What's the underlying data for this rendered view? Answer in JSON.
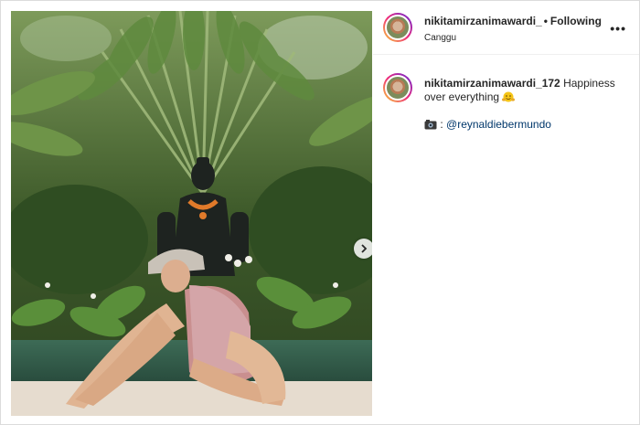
{
  "post": {
    "username": "nikitamirzanimawardi_",
    "dot": "•",
    "follow_status": "Following",
    "location": "Canggu",
    "more_icon": "•••"
  },
  "caption": {
    "username": "nikitamirzanimawardi_172",
    "text": "Happiness over everything",
    "emoji": "smiling-face-hands-emoji"
  },
  "credit": {
    "icon": "camera-emoji",
    "separator": ":",
    "mention": "@reynaldiebermundo"
  },
  "colors": {
    "link": "#00376b",
    "border": "#dbdbdb",
    "story_ring": "#ee2a7b"
  }
}
